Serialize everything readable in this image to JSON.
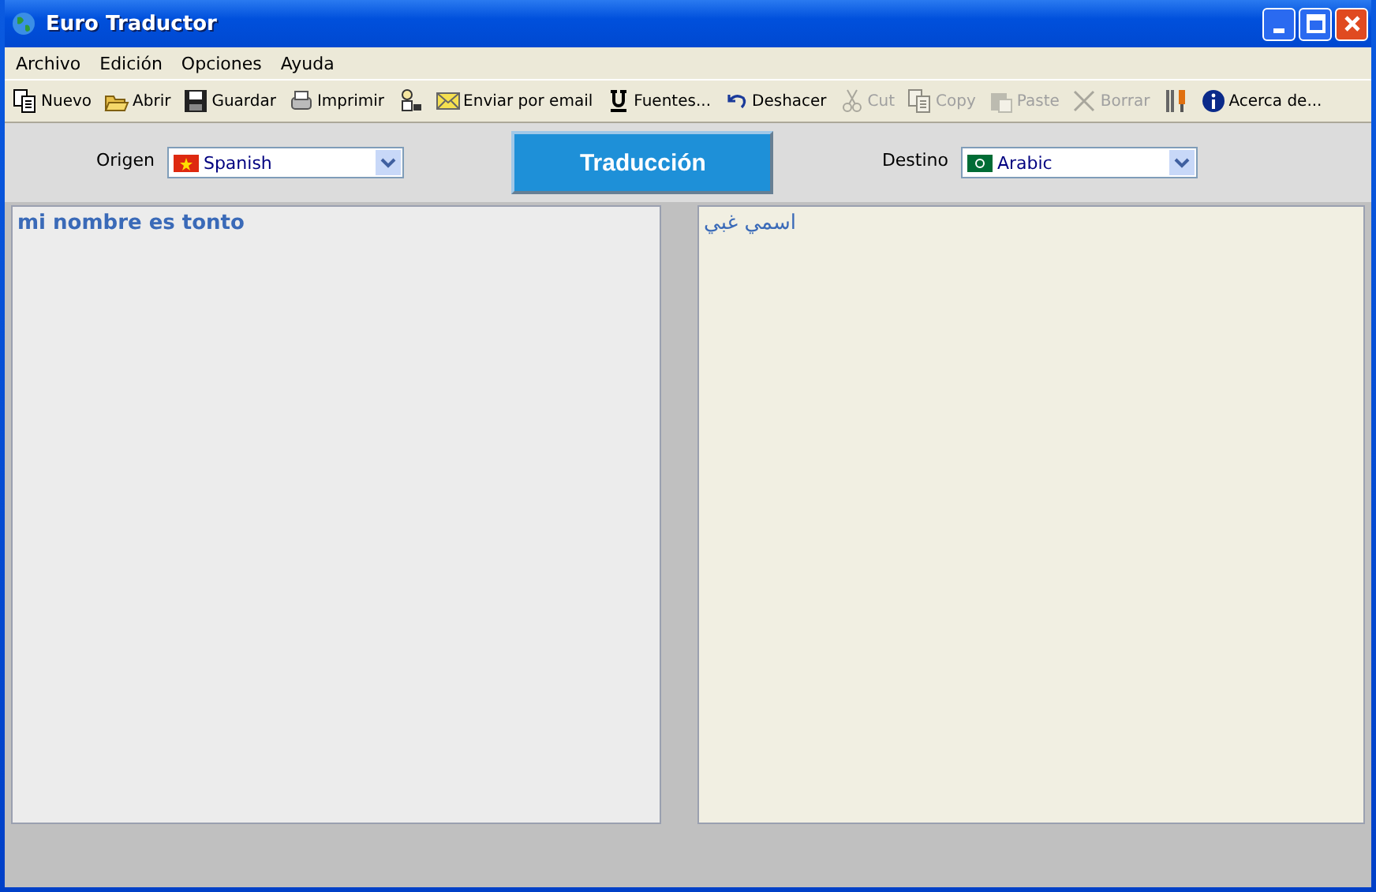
{
  "window": {
    "title": "Euro Traductor"
  },
  "menu": [
    "Archivo",
    "Edición",
    "Opciones",
    "Ayuda"
  ],
  "toolbar": [
    {
      "label": "Nuevo",
      "disabled": false
    },
    {
      "label": "Abrir",
      "disabled": false
    },
    {
      "label": "Guardar",
      "disabled": false
    },
    {
      "label": "Imprimir",
      "disabled": false
    },
    {
      "disabled": false
    },
    {
      "label": "Enviar por email",
      "disabled": false
    },
    {
      "label": "Fuentes...",
      "disabled": false
    },
    {
      "label": "Deshacer",
      "disabled": false
    },
    {
      "label": "Cut",
      "disabled": true
    },
    {
      "label": "Copy",
      "disabled": true
    },
    {
      "label": "Paste",
      "disabled": true
    },
    {
      "label": "Borrar",
      "disabled": true
    },
    {
      "disabled": false
    },
    {
      "label": "Acerca de...",
      "disabled": false
    }
  ],
  "source": {
    "label": "Origen",
    "language": "Spanish"
  },
  "translate_button": "Traducción",
  "target": {
    "label": "Destino",
    "language": "Arabic"
  },
  "source_text": "mi nombre es tonto",
  "target_text": "اسمي غبي"
}
